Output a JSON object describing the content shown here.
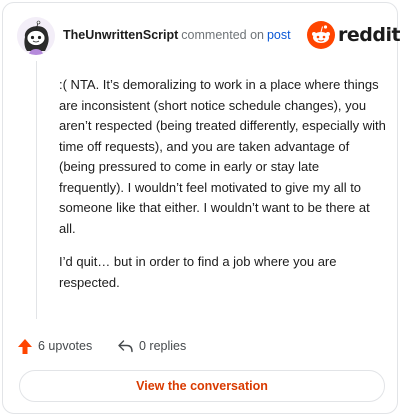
{
  "comment_card": {
    "username": "TheUnwrittenScript",
    "commented_text": "commented on",
    "post_link": "post",
    "brand": "reddit",
    "paragraphs": [
      ":( NTA. It’s demoralizing to work in a place where things are inconsistent (short notice schedule changes), you aren’t respected (being treated differently, especially with time off requests), and you are taken advantage of (being pressured to come in early or stay late frequently). I wouldn’t feel motivated to give my all to someone like that either. I wouldn’t want to be there at all.",
      "I’d quit… but in order to find a job where you are respected."
    ],
    "upvotes_label": "6 upvotes",
    "replies_label": "0 replies",
    "view_button": "View the conversation"
  },
  "colors": {
    "brand_orange": "#ff4500",
    "link_blue": "#0a58d6",
    "button_text": "#d93a00",
    "border": "#e2e4e7"
  },
  "icons": {
    "avatar": "snoo-avatar",
    "logo": "reddit-snoo-icon",
    "upvote": "upvote-arrow-icon",
    "reply": "reply-arrow-icon"
  }
}
